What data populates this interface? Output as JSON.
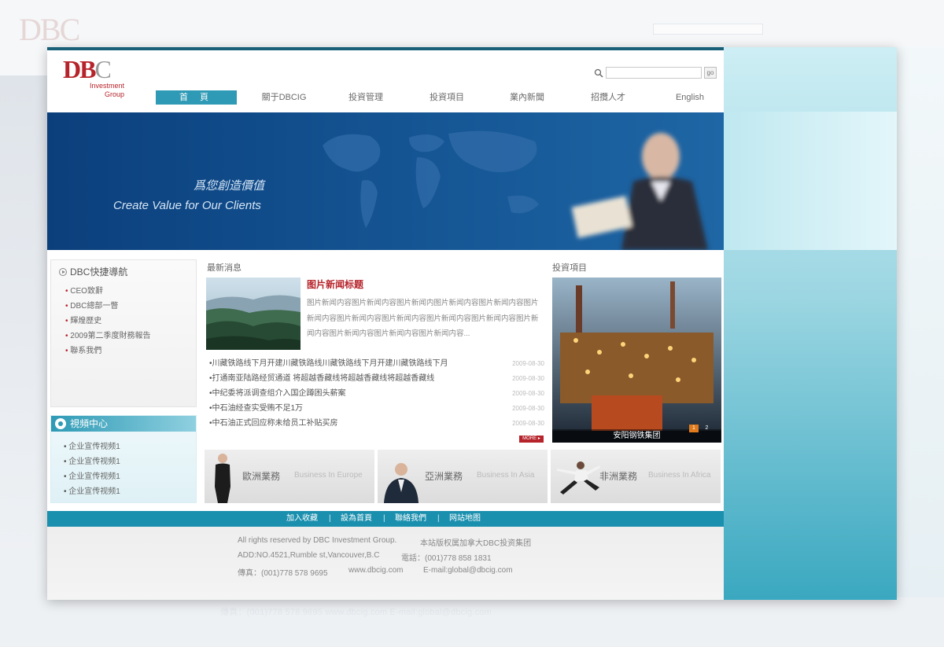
{
  "ghost": {
    "logo": "DBC",
    "footer": "傳真：(001)778 578 9695      www.dbcig.com      E-mail:global@dbcig.com"
  },
  "header": {
    "logo_main": "DB",
    "logo_c": "C",
    "logo_sub1": "Investment",
    "logo_sub2": "Group",
    "search_button": "go"
  },
  "nav": [
    {
      "label": "首 頁",
      "active": true
    },
    {
      "label": "關于DBCIG"
    },
    {
      "label": "投資管理"
    },
    {
      "label": "投資項目"
    },
    {
      "label": "業內新聞"
    },
    {
      "label": "招攬人才"
    },
    {
      "label": "English"
    }
  ],
  "banner": {
    "slogan_cn": "爲您創造價值",
    "slogan_en": "Create Value for Our Clients"
  },
  "quick_nav": {
    "title": "DBC快捷導航",
    "items": [
      "CEO致辭",
      "DBC總部一瞥",
      "輝煌歷史",
      "2009第二季度財務報告",
      "聯系我們"
    ]
  },
  "video": {
    "title": "視頻中心",
    "items": [
      "企业宣传视频1",
      "企业宣传视频1",
      "企业宣传视频1",
      "企业宣传视频1"
    ]
  },
  "news": {
    "section_title": "最新消息",
    "headline": "图片新闻标题",
    "summary": "图片新闻内容图片新闻内容图片新闻内图片新闻内容图片新闻内容图片新闻内容图片新闻内容图片新闻内容图片新闻内容图片新闻内容图片新闻内容图片新闻内容图片新闻内容图片新闻内容...",
    "items": [
      {
        "title": "•川藏铁路线下月开建川藏铁路线川藏铁路线下月开建川藏铁路线下月",
        "date": "2009-08-30"
      },
      {
        "title": "•打通南亚陆路经贸通道  将超越香藏线将超越香藏线将超越香藏线",
        "date": "2009-08-30"
      },
      {
        "title": "•中纪委将派调查组介入国企蹲困头薪案",
        "date": "2009-08-30"
      },
      {
        "title": "•中石油经查实受贿不足1万",
        "date": "2009-08-30"
      },
      {
        "title": "•中石油正式回应称未给员工补贴买房",
        "date": "2009-08-30"
      }
    ],
    "more": "MORE ▸"
  },
  "project": {
    "section_title": "投資項目",
    "caption": "安阳钢铁集团",
    "pages": [
      "1",
      "2"
    ]
  },
  "business": [
    {
      "cn": "歐洲業務",
      "en": "Business In Europe"
    },
    {
      "cn": "亞洲業務",
      "en": "Business In Asia"
    },
    {
      "cn": "非洲業務",
      "en": "Business In Africa"
    }
  ],
  "footer_nav": [
    "加入收藏",
    "設為首頁",
    "聯絡我們",
    "网站地图"
  ],
  "footer": {
    "line1a": "All rights reserved by DBC Investment Group.",
    "line1b": "本站版权属加拿大DBC投资集团",
    "line2a": "ADD:NO.4521,Rumble st,Vancouver,B.C",
    "line2b": "電話：(001)778 858 1831",
    "line3a": "傳真：(001)778 578 9695",
    "line3b": "www.dbcig.com",
    "line3c": "E-mail:global@dbcig.com"
  },
  "colors": {
    "brand_red": "#b6232a",
    "teal": "#2e9ab5",
    "banner_blue": "#0b3f7c"
  }
}
